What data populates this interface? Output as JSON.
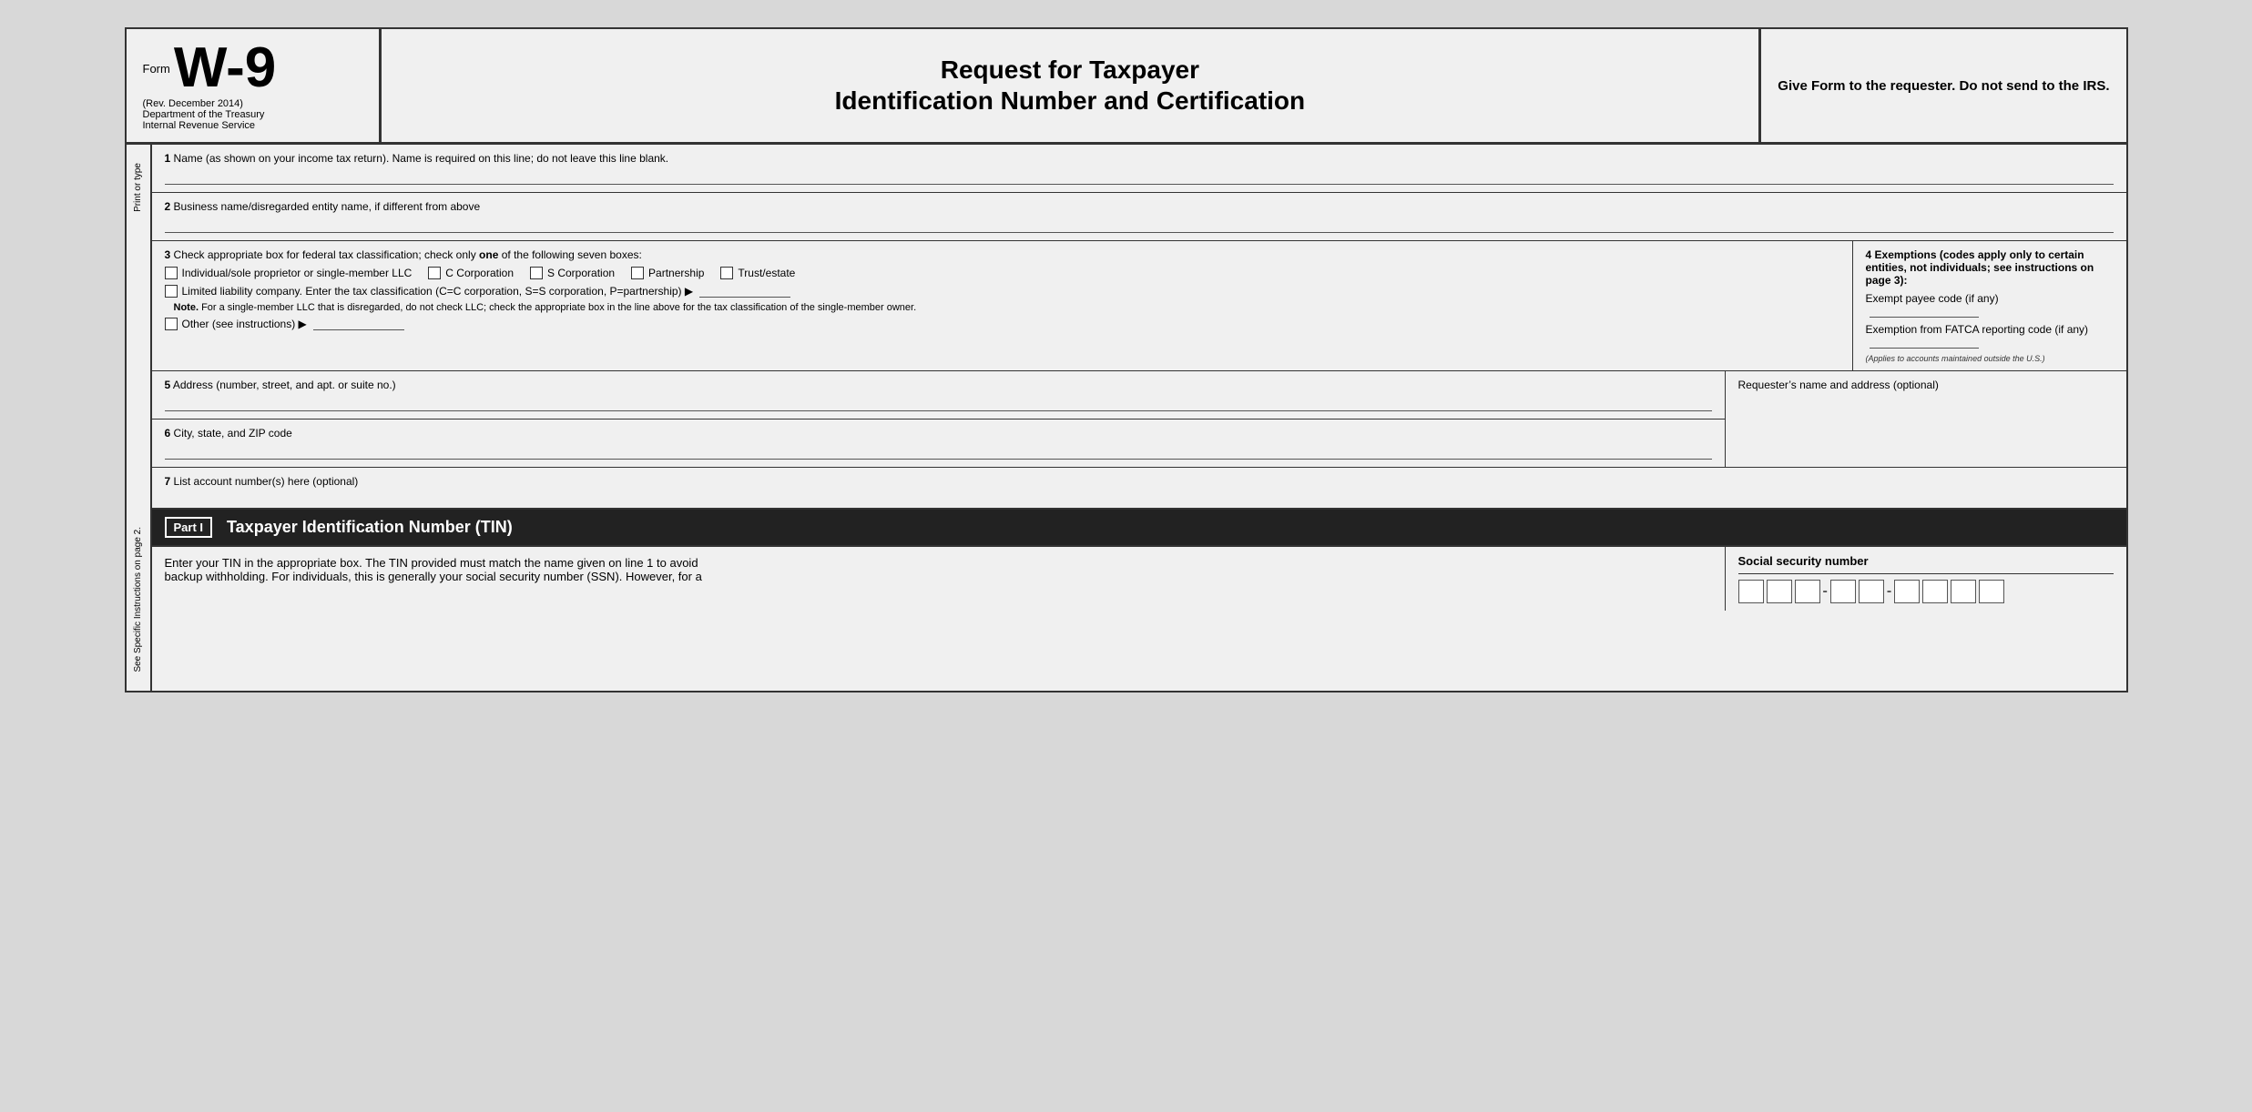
{
  "header": {
    "form_label": "Form",
    "form_number": "W-9",
    "form_rev": "(Rev. December 2014)",
    "dept1": "Department of the Treasury",
    "dept2": "Internal Revenue Service",
    "title_line1": "Request for Taxpayer",
    "title_line2": "Identification Number and Certification",
    "right_text": "Give Form to the requester. Do not send to the IRS."
  },
  "sidebar": {
    "top_text": "Print or type",
    "bottom_text": "See Specific Instructions on page 2."
  },
  "fields": {
    "field1_label": "1",
    "field1_desc": "Name (as shown on your income tax return). Name is required on this line; do not leave this line blank.",
    "field2_label": "2",
    "field2_desc": "Business name/disregarded entity name, if different from above",
    "field3_label": "3",
    "field3_desc": "Check appropriate box for federal tax classification; check only",
    "field3_desc_bold": "one",
    "field3_desc2": "of the following seven boxes:",
    "checkbox1": "Individual/sole proprietor or single-member LLC",
    "checkbox2": "C Corporation",
    "checkbox3": "S Corporation",
    "checkbox4": "Partnership",
    "checkbox5": "Trust/estate",
    "llc_text": "Limited liability company. Enter the tax classification (C=C corporation, S=S corporation, P=partnership) ▶",
    "note_label": "Note.",
    "note_text": "For a single-member LLC that is disregarded, do not check LLC; check the appropriate box in the line above for the tax classification of the single-member owner.",
    "other_text": "Other (see instructions) ▶",
    "field4_label": "4",
    "field4_desc": "Exemptions (codes apply only to certain entities, not individuals; see instructions on page 3):",
    "exempt_payee_label": "Exempt payee code (if any)",
    "fatca_label": "Exemption from FATCA reporting code (if any)",
    "fatca_note": "(Applies to accounts maintained outside the U.S.)",
    "field5_label": "5",
    "field5_desc": "Address (number, street, and apt. or suite no.)",
    "requester_label": "Requester’s name and address (optional)",
    "field6_label": "6",
    "field6_desc": "City, state, and ZIP code",
    "field7_label": "7",
    "field7_desc": "List account number(s) here (optional)"
  },
  "part1": {
    "badge": "Part I",
    "title": "Taxpayer Identification Number (TIN)",
    "desc1": "Enter your TIN in the appropriate box. The TIN provided must match the name given on line 1 to avoid",
    "desc2": "backup withholding. For individuals, this is generally your social security number (SSN). However, for a",
    "ssn_label": "Social security number"
  }
}
